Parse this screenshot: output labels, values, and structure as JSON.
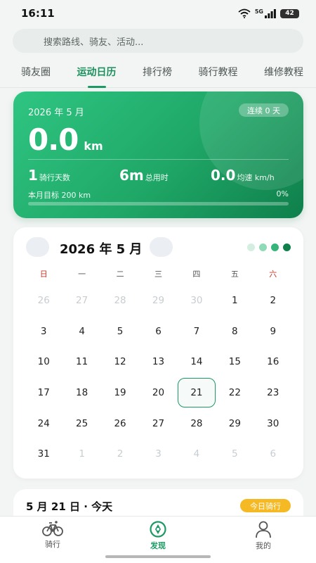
{
  "status_bar": {
    "time": "16:11",
    "network": "5G",
    "battery": "42"
  },
  "search": {
    "placeholder": "搜索路线、骑友、活动..."
  },
  "tabs": [
    {
      "label": "骑友圈",
      "active": false
    },
    {
      "label": "运动日历",
      "active": true
    },
    {
      "label": "排行榜",
      "active": false
    },
    {
      "label": "骑行教程",
      "active": false
    },
    {
      "label": "维修教程",
      "active": false
    }
  ],
  "stats": {
    "month": "2026 年 5 月",
    "streak_badge": "连续 0 天",
    "distance_value": "0.0",
    "distance_unit": "km",
    "ride_days_value": "1",
    "ride_days_label": "骑行天数",
    "duration_value": "6m",
    "duration_label": "总用时",
    "speed_value": "0.0",
    "speed_label": "均速 km/h",
    "goal_label": "本月目标 200 km",
    "goal_percent": "0%",
    "goal_progress": 0
  },
  "calendar": {
    "title": "2026 年 5 月",
    "legend_colors": [
      "#d4efe2",
      "#8fdab7",
      "#36b57a",
      "#0f7f4b"
    ],
    "weekdays": [
      "日",
      "一",
      "二",
      "三",
      "四",
      "五",
      "六"
    ],
    "days": [
      {
        "d": "26",
        "muted": true
      },
      {
        "d": "27",
        "muted": true
      },
      {
        "d": "28",
        "muted": true
      },
      {
        "d": "29",
        "muted": true
      },
      {
        "d": "30",
        "muted": true
      },
      {
        "d": "1"
      },
      {
        "d": "2"
      },
      {
        "d": "3"
      },
      {
        "d": "4"
      },
      {
        "d": "5"
      },
      {
        "d": "6"
      },
      {
        "d": "7"
      },
      {
        "d": "8"
      },
      {
        "d": "9"
      },
      {
        "d": "10"
      },
      {
        "d": "11"
      },
      {
        "d": "12"
      },
      {
        "d": "13"
      },
      {
        "d": "14"
      },
      {
        "d": "15"
      },
      {
        "d": "16"
      },
      {
        "d": "17"
      },
      {
        "d": "18"
      },
      {
        "d": "19"
      },
      {
        "d": "20"
      },
      {
        "d": "21",
        "today": true
      },
      {
        "d": "22"
      },
      {
        "d": "23"
      },
      {
        "d": "24"
      },
      {
        "d": "25"
      },
      {
        "d": "26"
      },
      {
        "d": "27"
      },
      {
        "d": "28"
      },
      {
        "d": "29"
      },
      {
        "d": "30"
      },
      {
        "d": "31"
      },
      {
        "d": "1",
        "muted": true
      },
      {
        "d": "2",
        "muted": true
      },
      {
        "d": "3",
        "muted": true
      },
      {
        "d": "4",
        "muted": true
      },
      {
        "d": "5",
        "muted": true
      },
      {
        "d": "6",
        "muted": true
      }
    ]
  },
  "day_detail": {
    "title": "5 月 21 日 · 今天",
    "badge": "今日骑行"
  },
  "bottom_nav": [
    {
      "label": "骑行",
      "icon": "bicycle-icon",
      "active": false
    },
    {
      "label": "发现",
      "icon": "compass-icon",
      "active": true
    },
    {
      "label": "我的",
      "icon": "person-icon",
      "active": false
    }
  ],
  "colors": {
    "accent": "#1b9a63",
    "badge_yellow": "#f5b923"
  }
}
